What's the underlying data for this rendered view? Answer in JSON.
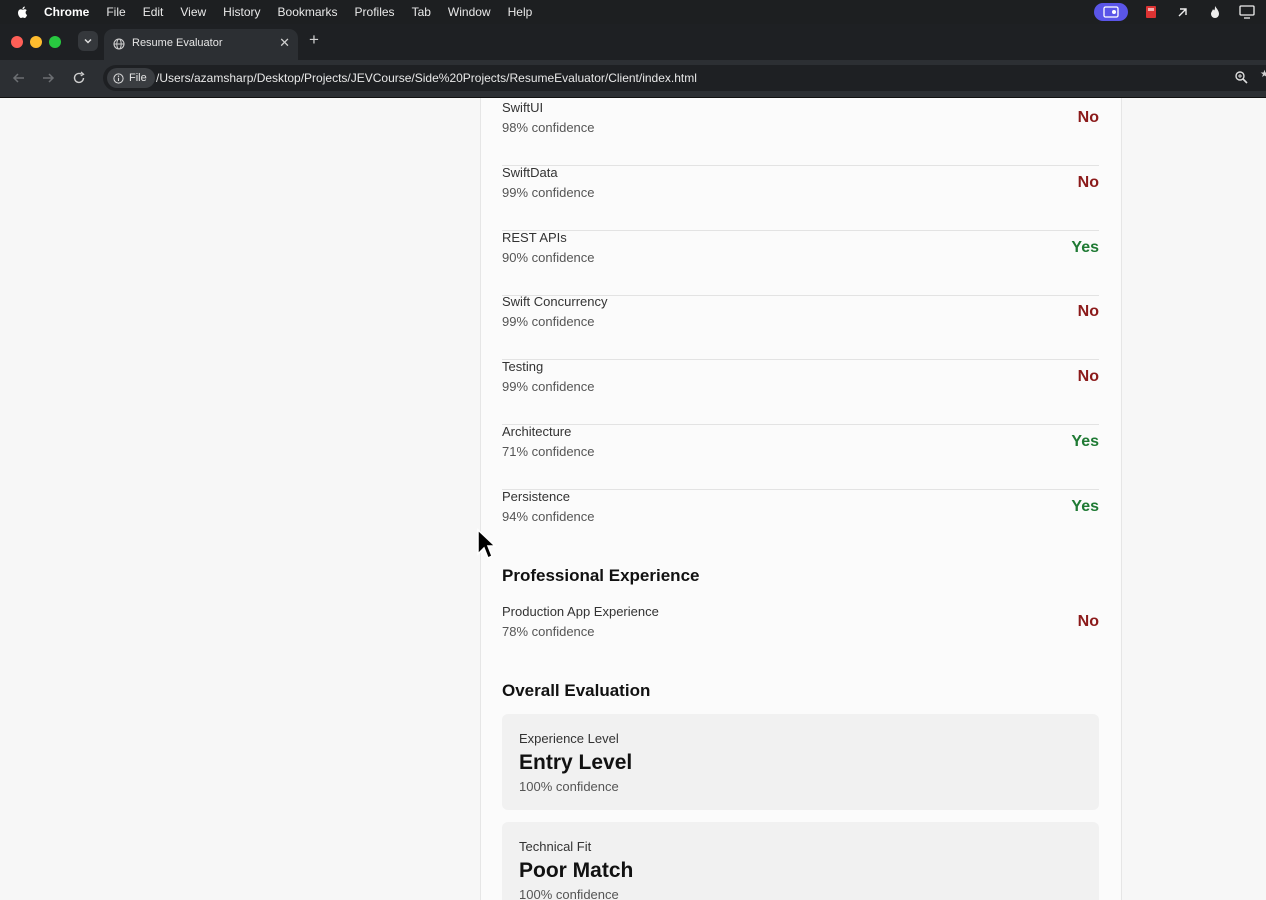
{
  "menubar": {
    "app": "Chrome",
    "items": [
      "File",
      "Edit",
      "View",
      "History",
      "Bookmarks",
      "Profiles",
      "Tab",
      "Window",
      "Help"
    ]
  },
  "tab": {
    "title": "Resume Evaluator"
  },
  "omnibox": {
    "chip": "File",
    "url": "/Users/azamsharp/Desktop/Projects/JEVCourse/Side%20Projects/ResumeEvaluator/Client/index.html"
  },
  "skills": [
    {
      "name": "SwiftUI",
      "confidence": "98% confidence",
      "verdict": "No"
    },
    {
      "name": "SwiftData",
      "confidence": "99% confidence",
      "verdict": "No"
    },
    {
      "name": "REST APIs",
      "confidence": "90% confidence",
      "verdict": "Yes"
    },
    {
      "name": "Swift Concurrency",
      "confidence": "99% confidence",
      "verdict": "No"
    },
    {
      "name": "Testing",
      "confidence": "99% confidence",
      "verdict": "No"
    },
    {
      "name": "Architecture",
      "confidence": "71% confidence",
      "verdict": "Yes"
    },
    {
      "name": "Persistence",
      "confidence": "94% confidence",
      "verdict": "Yes"
    }
  ],
  "professional": {
    "heading": "Professional Experience",
    "items": [
      {
        "name": "Production App Experience",
        "confidence": "78% confidence",
        "verdict": "No"
      }
    ]
  },
  "overall": {
    "heading": "Overall Evaluation",
    "experience": {
      "label": "Experience Level",
      "value": "Entry Level",
      "confidence": "100% confidence"
    },
    "technical": {
      "label": "Technical Fit",
      "value": "Poor Match",
      "confidence": "100% confidence"
    }
  },
  "colors": {
    "no": "#8b1a1a",
    "yes": "#1f7a34"
  }
}
